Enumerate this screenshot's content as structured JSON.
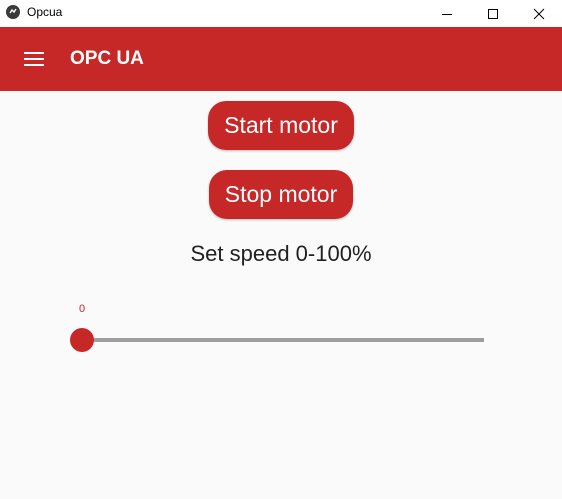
{
  "window": {
    "title": "Opcua",
    "controls": [
      "minimize-icon",
      "maximize-icon",
      "close-icon"
    ]
  },
  "appbar": {
    "title": "OPC UA",
    "menu_icon": "hamburger-menu-icon",
    "color": "#c62828"
  },
  "main": {
    "start_button_label": "Start motor",
    "stop_button_label": "Stop motor",
    "speed_label": "Set speed 0-100%",
    "speed_slider": {
      "value_text": "0",
      "value": 0,
      "min": 0,
      "max": 100
    }
  },
  "colors": {
    "accent": "#c62828",
    "background": "#fafafa",
    "track": "#9e9e9e"
  }
}
